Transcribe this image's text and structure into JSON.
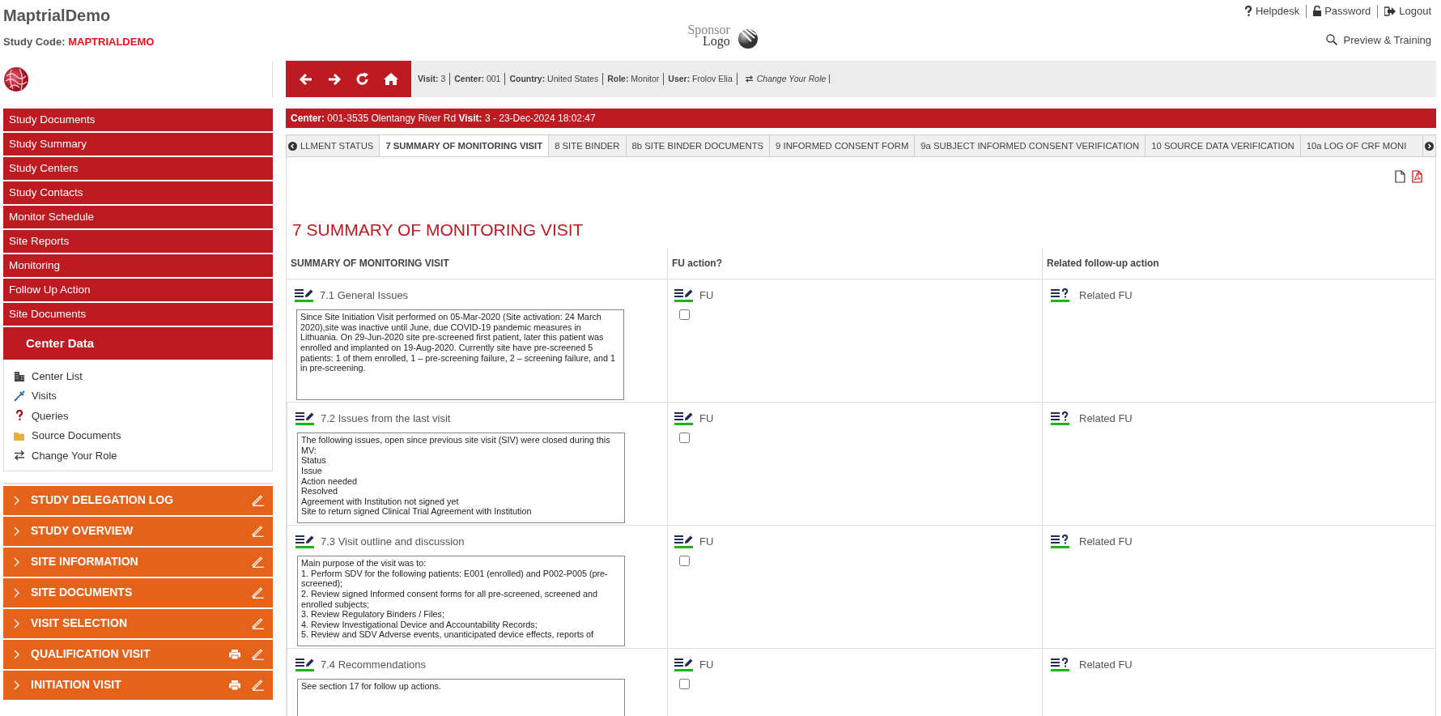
{
  "app": {
    "title": "MaptrialDemo",
    "study_code_label": "Study Code:",
    "study_code": "MAPTRIALDEMO"
  },
  "sponsor_logo": {
    "line_1": "Sponsor",
    "line_2": "Logo"
  },
  "header_links": [
    {
      "label": "Helpdesk"
    },
    {
      "label": "Password"
    },
    {
      "label": "Logout"
    }
  ],
  "preview_link": "Preview & Training",
  "context_bar": {
    "fields": [
      {
        "label": "Visit:",
        "value": "3"
      },
      {
        "label": "Center:",
        "value": "001"
      },
      {
        "label": "Country:",
        "value": "United States"
      },
      {
        "label": "Role:",
        "value": "Monitor"
      },
      {
        "label": "User:",
        "value": "Frolov Elia"
      }
    ],
    "change_role": "Change Your Role"
  },
  "sidebar": {
    "menu": [
      "Study Documents",
      "Study Summary",
      "Study Centers",
      "Study Contacts",
      "Monitor Schedule",
      "Site Reports",
      "Monitoring",
      "Follow Up Action",
      "Site Documents"
    ],
    "center_data": {
      "title": "Center Data",
      "items": [
        "Center List",
        "Visits",
        "Queries",
        "Source Documents",
        "Change Your Role"
      ]
    },
    "sections": [
      {
        "label": "STUDY DELEGATION LOG",
        "printable": false
      },
      {
        "label": "STUDY OVERVIEW",
        "printable": false
      },
      {
        "label": "SITE INFORMATION",
        "printable": false
      },
      {
        "label": "SITE DOCUMENTS",
        "printable": false
      },
      {
        "label": "VISIT SELECTION",
        "printable": false
      },
      {
        "label": "QUALIFICATION VISIT",
        "printable": true
      },
      {
        "label": "INITIATION VISIT",
        "printable": true
      }
    ]
  },
  "center_bar": {
    "center_label": "Center:",
    "center": "001-3535 Olentangy River Rd",
    "visit_label": "Visit:",
    "visit": "3 - 23-Dec-2024 18:02:47"
  },
  "tabs": [
    {
      "label": "LLMENT STATUS",
      "selected": false
    },
    {
      "label": "7 SUMMARY OF MONITORING VISIT",
      "selected": true
    },
    {
      "label": "8 SITE BINDER",
      "selected": false
    },
    {
      "label": "8b SITE BINDER DOCUMENTS",
      "selected": false
    },
    {
      "label": "9 INFORMED CONSENT FORM",
      "selected": false
    },
    {
      "label": "9a SUBJECT INFORMED CONSENT VERIFICATION",
      "selected": false
    },
    {
      "label": "10 SOURCE DATA VERIFICATION",
      "selected": false
    },
    {
      "label": "10a LOG OF CRF MONI",
      "selected": false
    }
  ],
  "form": {
    "title": "7 SUMMARY OF MONITORING VISIT",
    "columns": [
      "SUMMARY OF MONITORING VISIT",
      "FU action?",
      "Related follow-up action"
    ],
    "rows": [
      {
        "label": "7.1 General Issues",
        "text": "Since Site Initiation Visit performed on 05-Mar-2020 (Site activation: 24 March 2020),site was inactive until June, due COVID-19 pandemic measures in Lithuania. On 29-Jun-2020 site pre-screened first patient, later this patient was enrolled and implanted on 19-Aug-2020. Currently site have pre-screened 5 patients: 1 of them enrolled, 1 – pre-screening failure, 2 – screening failure, and 1 in pre-screening.",
        "fu_label": "FU",
        "fu_checked": false,
        "related_label": "Related FU"
      },
      {
        "label": "7.2 Issues from the last visit",
        "text": "The following issues, open since previous site visit (SIV) were closed during this MV:\nStatus\nIssue\nAction needed\nResolved\nAgreement with Institution not signed yet\nSite to return signed Clinical Trial Agreement with Institution",
        "fu_label": "FU",
        "fu_checked": false,
        "related_label": "Related FU"
      },
      {
        "label": "7.3 Visit outline and discussion",
        "text": "Main purpose of the visit was to:\n1. Perform SDV for the following patients: E001 (enrolled) and P002-P005 (pre-screened);\n2. Review signed Informed consent forms for all pre-screened, screened and enrolled subjects;\n3. Review Regulatory Binders / Files;\n4. Review Investigational Device and Accountability Records;\n5. Review and SDV Adverse events, unanticipated device effects, reports of",
        "fu_label": "FU",
        "fu_checked": false,
        "related_label": "Related FU"
      },
      {
        "label": "7.4 Recommendations",
        "text": "See section 17 for follow up actions.",
        "fu_label": "FU",
        "fu_checked": false,
        "related_label": "Related FU"
      }
    ]
  }
}
